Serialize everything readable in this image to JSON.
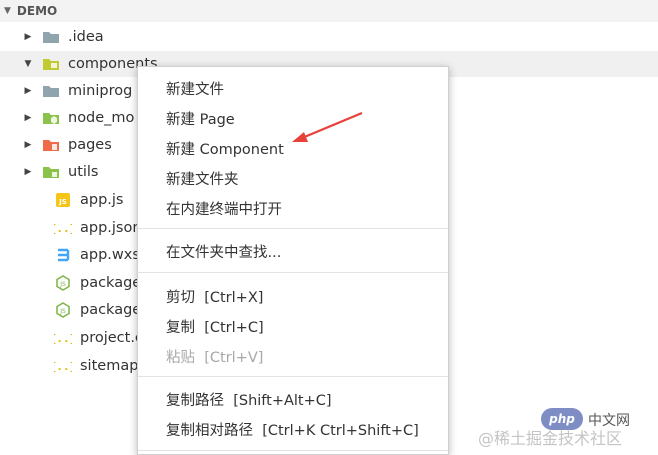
{
  "explorer": {
    "section_title": "DEMO",
    "items": [
      {
        "label": ".idea",
        "kind": "folder",
        "icon": "folder-icon",
        "expanded": false
      },
      {
        "label": "components",
        "kind": "folder",
        "icon": "components-folder-icon",
        "expanded": true
      },
      {
        "label": "miniprog",
        "kind": "folder",
        "icon": "folder-icon",
        "expanded": false
      },
      {
        "label": "node_mo",
        "kind": "folder",
        "icon": "node-folder-icon",
        "expanded": false
      },
      {
        "label": "pages",
        "kind": "folder",
        "icon": "pages-folder-icon",
        "expanded": false
      },
      {
        "label": "utils",
        "kind": "folder",
        "icon": "utils-folder-icon",
        "expanded": false
      },
      {
        "label": "app.js",
        "kind": "file",
        "icon": "js-file-icon"
      },
      {
        "label": "app.json",
        "kind": "file",
        "icon": "json-file-icon"
      },
      {
        "label": "app.wxss",
        "kind": "file",
        "icon": "css-file-icon"
      },
      {
        "label": "package-",
        "kind": "file",
        "icon": "node-file-icon"
      },
      {
        "label": "package.j",
        "kind": "file",
        "icon": "node-file-icon"
      },
      {
        "label": "project.co",
        "kind": "file",
        "icon": "json-file-icon"
      },
      {
        "label": "sitemap.js",
        "kind": "file",
        "icon": "json-file-icon"
      }
    ]
  },
  "context_menu": {
    "groups": [
      [
        "新建文件",
        "新建 Page",
        "新建 Component",
        "新建文件夹",
        "在内建终端中打开"
      ],
      [
        "在文件夹中查找..."
      ],
      [
        "剪切  [Ctrl+X]",
        "复制  [Ctrl+C]",
        "粘贴  [Ctrl+V]"
      ],
      [
        "复制路径  [Shift+Alt+C]",
        "复制相对路径  [Ctrl+K Ctrl+Shift+C]"
      ]
    ],
    "disabled_item": "粘贴  [Ctrl+V]"
  },
  "watermark": {
    "text": "@稀土掘金技术社区",
    "php_badge": "php",
    "php_site": "中文网"
  },
  "colors": {
    "arrow": "#e8413a",
    "folder_grey": "#90a4ae",
    "folder_green": "#8bc34a",
    "folder_red": "#ef5350",
    "js_yellow": "#f5c518",
    "json_yellow": "#e6b800",
    "css_blue": "#42a5f5",
    "node_green": "#7cb342"
  }
}
